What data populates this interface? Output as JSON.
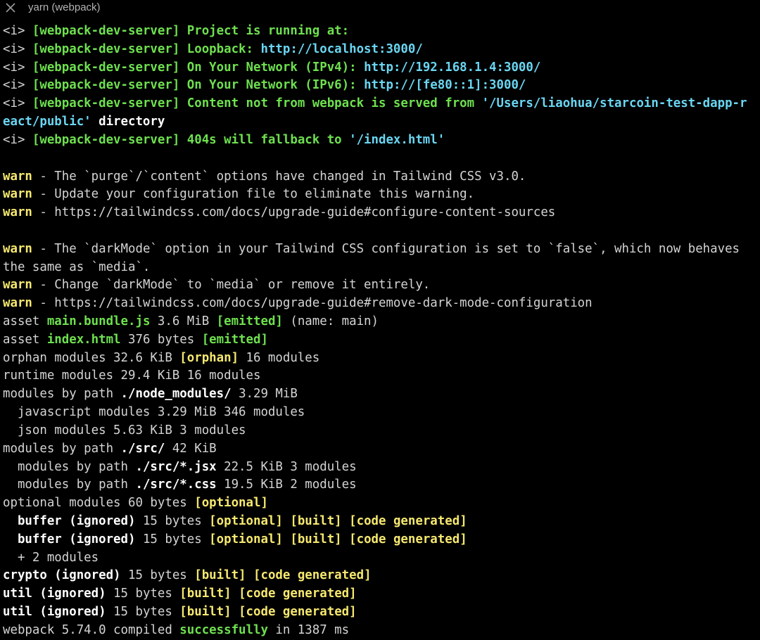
{
  "window": {
    "tab_title": "yarn (webpack)"
  },
  "colors": {
    "background": "#000000",
    "default": "#d4d4d4",
    "bold_white": "#ffffff",
    "green": "#6ee04f",
    "cyan": "#6ad6f2",
    "yellow": "#f5e86f",
    "titlebar_text": "#b4b4b4"
  },
  "icons": {
    "close": "close-icon"
  },
  "lines": [
    [
      [
        "w",
        "<i> "
      ],
      [
        "gb",
        "[webpack-dev-server]"
      ],
      [
        "gb",
        " Project is running at:"
      ]
    ],
    [
      [
        "w",
        "<i> "
      ],
      [
        "gb",
        "[webpack-dev-server]"
      ],
      [
        "gb",
        " Loopback: "
      ],
      [
        "cb",
        "http://localhost:3000/"
      ]
    ],
    [
      [
        "w",
        "<i> "
      ],
      [
        "gb",
        "[webpack-dev-server]"
      ],
      [
        "gb",
        " On Your Network (IPv4): "
      ],
      [
        "cb",
        "http://192.168.1.4:3000/"
      ]
    ],
    [
      [
        "w",
        "<i> "
      ],
      [
        "gb",
        "[webpack-dev-server]"
      ],
      [
        "gb",
        " On Your Network (IPv6): "
      ],
      [
        "cb",
        "http://[fe80::1]:3000/"
      ]
    ],
    [
      [
        "w",
        "<i> "
      ],
      [
        "gb",
        "[webpack-dev-server]"
      ],
      [
        "gb",
        " Content not from webpack is served from "
      ],
      [
        "cb",
        "'/Users/liaohua/starcoin-test-dapp-r"
      ]
    ],
    [
      [
        "cb",
        "eact/public'"
      ],
      [
        "wb",
        " directory"
      ]
    ],
    [
      [
        "w",
        "<i> "
      ],
      [
        "gb",
        "[webpack-dev-server]"
      ],
      [
        "gb",
        " 404s will fallback to "
      ],
      [
        "cb",
        "'/index.html'"
      ]
    ],
    [],
    [
      [
        "yb",
        "warn"
      ],
      [
        "w",
        " - The `purge`/`content` options have changed in Tailwind CSS v3.0."
      ]
    ],
    [
      [
        "yb",
        "warn"
      ],
      [
        "w",
        " - Update your configuration file to eliminate this warning."
      ]
    ],
    [
      [
        "yb",
        "warn"
      ],
      [
        "w",
        " - https://tailwindcss.com/docs/upgrade-guide#configure-content-sources"
      ]
    ],
    [],
    [
      [
        "yb",
        "warn"
      ],
      [
        "w",
        " - The `darkMode` option in your Tailwind CSS configuration is set to `false`, which now behaves"
      ]
    ],
    [
      [
        "w",
        "the same as `media`."
      ]
    ],
    [
      [
        "yb",
        "warn"
      ],
      [
        "w",
        " - Change `darkMode` to `media` or remove it entirely."
      ]
    ],
    [
      [
        "yb",
        "warn"
      ],
      [
        "w",
        " - https://tailwindcss.com/docs/upgrade-guide#remove-dark-mode-configuration"
      ]
    ],
    [
      [
        "w",
        "asset "
      ],
      [
        "gb",
        "main.bundle.js"
      ],
      [
        "w",
        " 3.6 MiB "
      ],
      [
        "gb",
        "[emitted]"
      ],
      [
        "w",
        " (name: main)"
      ]
    ],
    [
      [
        "w",
        "asset "
      ],
      [
        "gb",
        "index.html"
      ],
      [
        "w",
        " 376 bytes "
      ],
      [
        "gb",
        "[emitted]"
      ]
    ],
    [
      [
        "w",
        "orphan modules 32.6 KiB "
      ],
      [
        "yb",
        "[orphan]"
      ],
      [
        "w",
        " 16 modules"
      ]
    ],
    [
      [
        "w",
        "runtime modules 29.4 KiB 16 modules"
      ]
    ],
    [
      [
        "w",
        "modules by path "
      ],
      [
        "wb",
        "./node_modules/"
      ],
      [
        "w",
        " 3.29 MiB"
      ]
    ],
    [
      [
        "w",
        "  javascript modules 3.29 MiB 346 modules"
      ]
    ],
    [
      [
        "w",
        "  json modules 5.63 KiB 3 modules"
      ]
    ],
    [
      [
        "w",
        "modules by path "
      ],
      [
        "wb",
        "./src/"
      ],
      [
        "w",
        " 42 KiB"
      ]
    ],
    [
      [
        "w",
        "  modules by path "
      ],
      [
        "wb",
        "./src/*.jsx"
      ],
      [
        "w",
        " 22.5 KiB 3 modules"
      ]
    ],
    [
      [
        "w",
        "  modules by path "
      ],
      [
        "wb",
        "./src/*.css"
      ],
      [
        "w",
        " 19.5 KiB 2 modules"
      ]
    ],
    [
      [
        "w",
        "optional modules 60 bytes "
      ],
      [
        "yb",
        "[optional]"
      ]
    ],
    [
      [
        "wb",
        "  buffer (ignored)"
      ],
      [
        "w",
        " 15 bytes "
      ],
      [
        "yb",
        "[optional]"
      ],
      [
        "w",
        " "
      ],
      [
        "yb",
        "[built]"
      ],
      [
        "w",
        " "
      ],
      [
        "yb",
        "[code generated]"
      ]
    ],
    [
      [
        "wb",
        "  buffer (ignored)"
      ],
      [
        "w",
        " 15 bytes "
      ],
      [
        "yb",
        "[optional]"
      ],
      [
        "w",
        " "
      ],
      [
        "yb",
        "[built]"
      ],
      [
        "w",
        " "
      ],
      [
        "yb",
        "[code generated]"
      ]
    ],
    [
      [
        "w",
        "  + 2 modules"
      ]
    ],
    [
      [
        "wb",
        "crypto (ignored)"
      ],
      [
        "w",
        " 15 bytes "
      ],
      [
        "yb",
        "[built]"
      ],
      [
        "w",
        " "
      ],
      [
        "yb",
        "[code generated]"
      ]
    ],
    [
      [
        "wb",
        "util (ignored)"
      ],
      [
        "w",
        " 15 bytes "
      ],
      [
        "yb",
        "[built]"
      ],
      [
        "w",
        " "
      ],
      [
        "yb",
        "[code generated]"
      ]
    ],
    [
      [
        "wb",
        "util (ignored)"
      ],
      [
        "w",
        " 15 bytes "
      ],
      [
        "yb",
        "[built]"
      ],
      [
        "w",
        " "
      ],
      [
        "yb",
        "[code generated]"
      ]
    ],
    [
      [
        "w",
        "webpack 5.74.0 compiled "
      ],
      [
        "gb",
        "successfully"
      ],
      [
        "w",
        " in 1387 ms"
      ]
    ]
  ]
}
